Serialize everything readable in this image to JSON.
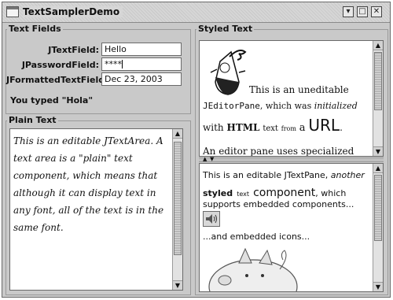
{
  "window": {
    "title": "TextSamplerDemo",
    "buttons": {
      "minimize": "▾",
      "maximize": "□",
      "close": "✕"
    }
  },
  "text_fields": {
    "section_title": "Text Fields",
    "text_field_label": "JTextField:",
    "text_field_value": "Hello",
    "password_label": "JPasswordField:",
    "password_value": "****",
    "formatted_label": "JFormattedTextField:",
    "formatted_value": "Dec 23, 2003",
    "status": "You typed \"Hola\""
  },
  "plain_text": {
    "section_title": "Plain Text",
    "content": "This is an editable JTextArea. A text area is a \"plain\" text component, which means that although it can display text in any font, all of the text is in the same font."
  },
  "styled_text": {
    "section_title": "Styled Text",
    "editor": {
      "t1": "This is an uneditable",
      "t2": "JEditorPane",
      "t3": ", which was",
      "t4": "initialized",
      "t5": "with",
      "t6": "HTML",
      "t7": "text",
      "t8": "from",
      "t9": "a",
      "t10": "URL",
      "t11": ".",
      "t12": "An editor pane uses specialized editor"
    },
    "textpane": {
      "p1": "This is an editable JTextPane,",
      "p2": "another",
      "p3": "styled",
      "p4": "text",
      "p5": "component",
      "p6": ", which",
      "p7": "supports embedded components...",
      "p8": "...and embedded icons..."
    }
  }
}
